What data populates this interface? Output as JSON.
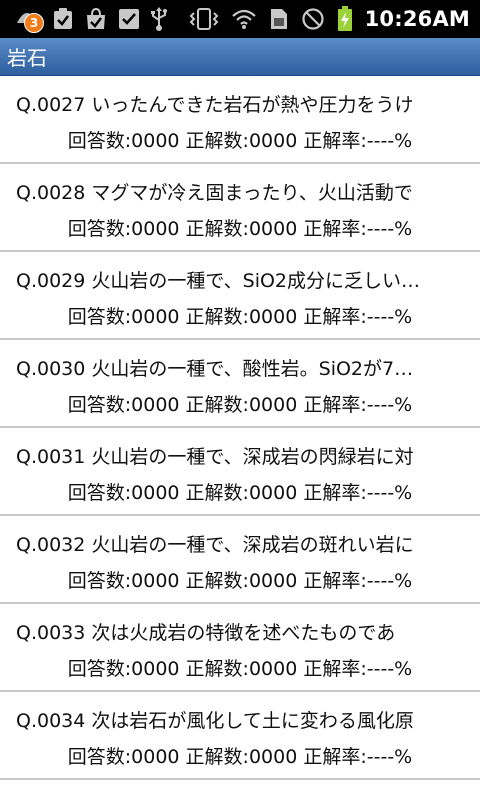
{
  "status_bar": {
    "notification_count": "3",
    "time": "10:26AM"
  },
  "header": {
    "title": "岩石"
  },
  "questions": [
    {
      "question": "Q.0027 いったんできた岩石が熱や圧力をうけ",
      "stats": "回答数:0000 正解数:0000 正解率:----%"
    },
    {
      "question": "Q.0028 マグマが冷え固まったり、火山活動で",
      "stats": "回答数:0000 正解数:0000 正解率:----%"
    },
    {
      "question": "Q.0029 火山岩の一種で、SiO2成分に乏しい…",
      "stats": "回答数:0000 正解数:0000 正解率:----%"
    },
    {
      "question": "Q.0030 火山岩の一種で、酸性岩。SiO2が7…",
      "stats": "回答数:0000 正解数:0000 正解率:----%"
    },
    {
      "question": "Q.0031 火山岩の一種で、深成岩の閃緑岩に対",
      "stats": "回答数:0000 正解数:0000 正解率:----%"
    },
    {
      "question": "Q.0032 火山岩の一種で、深成岩の斑れい岩に",
      "stats": "回答数:0000 正解数:0000 正解率:----%"
    },
    {
      "question": "Q.0033 次は火成岩の特徴を述べたものであ",
      "stats": "回答数:0000 正解数:0000 正解率:----%"
    },
    {
      "question": "Q.0034 次は岩石が風化して土に変わる風化原",
      "stats": "回答数:0000 正解数:0000 正解率:----%"
    }
  ],
  "colors": {
    "title_bar": "#3f6fb0",
    "badge": "#f07c1a",
    "battery": "#9cd13a"
  }
}
